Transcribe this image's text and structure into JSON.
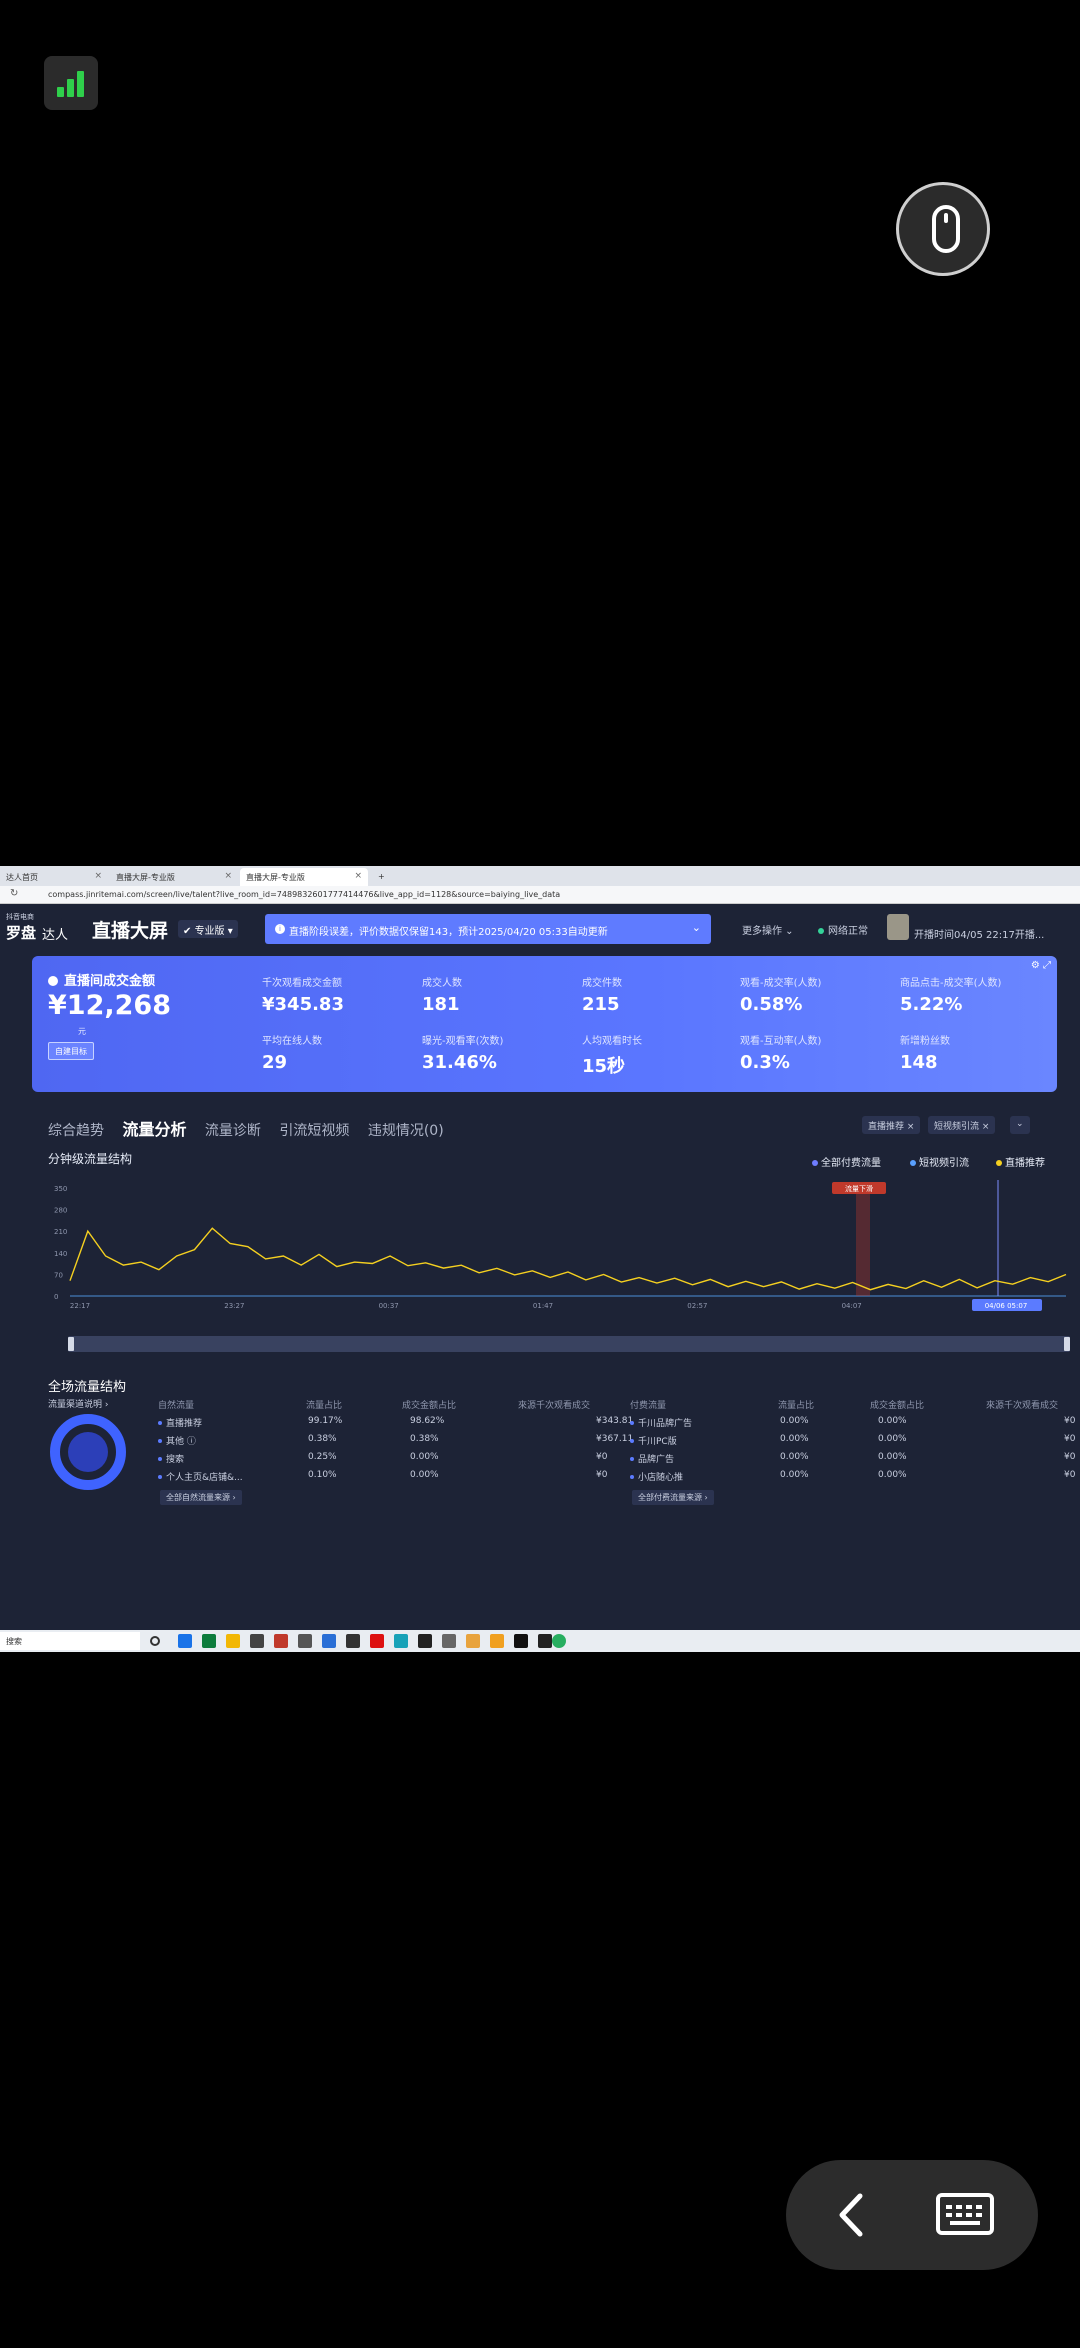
{
  "browser": {
    "tabs": [
      "达人首页",
      "直播大屏-专业版",
      "直播大屏-专业版"
    ],
    "url": "compass.jinritemai.com/screen/live/talent?live_room_id=7489832601777414476&live_app_id=1128&source=baiying_live_data"
  },
  "header": {
    "logo_small": "抖音电商",
    "logo": "罗盘",
    "logo_sub": "达人",
    "title": "直播大屏",
    "edition": "专业版",
    "notice": "直播阶段误差，评价数据仅保留143，预计2025/04/20 05:33自动更新",
    "more_ops": "更多操作",
    "net_status": "网络正常",
    "start_info": "开播时间04/05 22:17开播..."
  },
  "kpi": {
    "gmv_label": "直播间成交金额",
    "gmv_value": "¥12,268",
    "gmv_unit": "元",
    "target_btn": "自建目标",
    "items": [
      {
        "label": "千次观看成交金额",
        "value": "¥345.83"
      },
      {
        "label": "成交人数",
        "value": "181"
      },
      {
        "label": "成交件数",
        "value": "215"
      },
      {
        "label": "观看-成交率(人数)",
        "value": "0.58%"
      },
      {
        "label": "商品点击-成交率(人数)",
        "value": "5.22%"
      },
      {
        "label": "平均在线人数",
        "value": "29"
      },
      {
        "label": "曝光-观看率(次数)",
        "value": "31.46%"
      },
      {
        "label": "人均观看时长",
        "value": "15秒"
      },
      {
        "label": "观看-互动率(人数)",
        "value": "0.3%"
      },
      {
        "label": "新增粉丝数",
        "value": "148"
      }
    ]
  },
  "tabs": [
    "综合趋势",
    "流量分析",
    "流量诊断",
    "引流短视频",
    "违规情况(0)"
  ],
  "filters": [
    "直播推荐 ×",
    "短视频引流 ×",
    "⌄"
  ],
  "chart_section": {
    "title": "分钟级流量结构",
    "legend": [
      {
        "name": "全部付费流量",
        "color": "#6f7dff"
      },
      {
        "name": "短视频引流",
        "color": "#5aa0ff"
      },
      {
        "name": "直播推荐",
        "color": "#f5d020"
      }
    ],
    "marker_label": "流量下滑",
    "cursor_label": "04/06 05:07"
  },
  "chart_data": {
    "type": "line",
    "x_ticks": [
      "22:17",
      "23:27",
      "00:37",
      "01:47",
      "02:57",
      "04:07",
      "04/06 05:07"
    ],
    "y_ticks": [
      "350",
      "280",
      "210",
      "140",
      "70",
      "0"
    ],
    "ylim": [
      0,
      350
    ],
    "series": [
      {
        "name": "直播推荐",
        "color": "#f5d020",
        "values": [
          40,
          220,
          120,
          110,
          100,
          95,
          120,
          160,
          210,
          180,
          150,
          130,
          120,
          110,
          125,
          105,
          100,
          115,
          120,
          108,
          98,
          100,
          90,
          85,
          80,
          78,
          72,
          70,
          68,
          62,
          60,
          55,
          50,
          52,
          48,
          46,
          44,
          40,
          38,
          40,
          36,
          32,
          30,
          35,
          34,
          30,
          28,
          34,
          40,
          38,
          44,
          36,
          40,
          48,
          50,
          56,
          60
        ]
      }
    ]
  },
  "traffic_structure": {
    "title": "全场流量结构",
    "funnel_link": "流量渠道说明 ›",
    "natural": {
      "header": [
        "自然流量",
        "流量占比",
        "成交金额占比",
        "來源千次观看成交"
      ],
      "rows": [
        [
          "直播推荐",
          "99.17%",
          "98.62%",
          "¥343.81"
        ],
        [
          "其他 ⓘ",
          "0.38%",
          "0.38%",
          "¥367.11"
        ],
        [
          "搜索",
          "0.25%",
          "0.00%",
          "¥0"
        ],
        [
          "个人主页&店铺&...",
          "0.10%",
          "0.00%",
          "¥0"
        ]
      ],
      "more": "全部自然流量来源 ›"
    },
    "paid": {
      "header": [
        "付费流量",
        "流量占比",
        "成交金额占比",
        "來源千次观看成交"
      ],
      "rows": [
        [
          "千川品牌广告",
          "0.00%",
          "0.00%",
          "¥0"
        ],
        [
          "千川PC版",
          "0.00%",
          "0.00%",
          "¥0"
        ],
        [
          "品牌广告",
          "0.00%",
          "0.00%",
          "¥0"
        ],
        [
          "小店随心推",
          "0.00%",
          "0.00%",
          "¥0"
        ]
      ],
      "more": "全部付费流量来源 ›"
    }
  },
  "taskbar": {
    "search": "搜索"
  }
}
